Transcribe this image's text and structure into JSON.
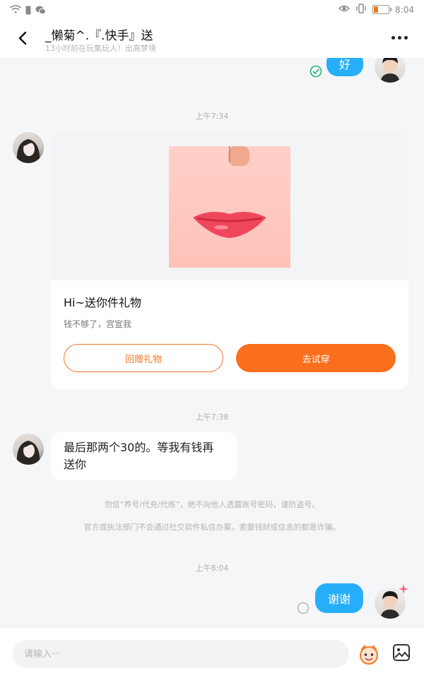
{
  "status_bar": {
    "time": "8:04"
  },
  "header": {
    "title": "_懒菊^.『.快手』送",
    "subtitle": "13小时前在玩集玩人！出高梦境"
  },
  "messages": {
    "top_reply": "好",
    "time_1": "上午7:34",
    "gift": {
      "title": "Hi~送你件礼物",
      "subtitle": "钱不够了，宫宣我",
      "return_label": "回赠礼物",
      "try_label": "去试穿"
    },
    "time_2": "上午7:38",
    "text_1": "最后那两个30的。等我有钱再送你",
    "notice_1": "勿信“养号/代充/代练”，绝不向他人透露账号密码，谨防盗号。",
    "notice_2": "官方或执法部门不会通过社交软件私信办案，索要钱财或信息的都是诈骗。",
    "time_3": "上午8:04",
    "thanks": "谢谢"
  },
  "input": {
    "placeholder": "请输入···"
  },
  "colors": {
    "accent_orange": "#f96f1c",
    "bubble_blue": "#27aef9",
    "read_green": "#22b573"
  }
}
